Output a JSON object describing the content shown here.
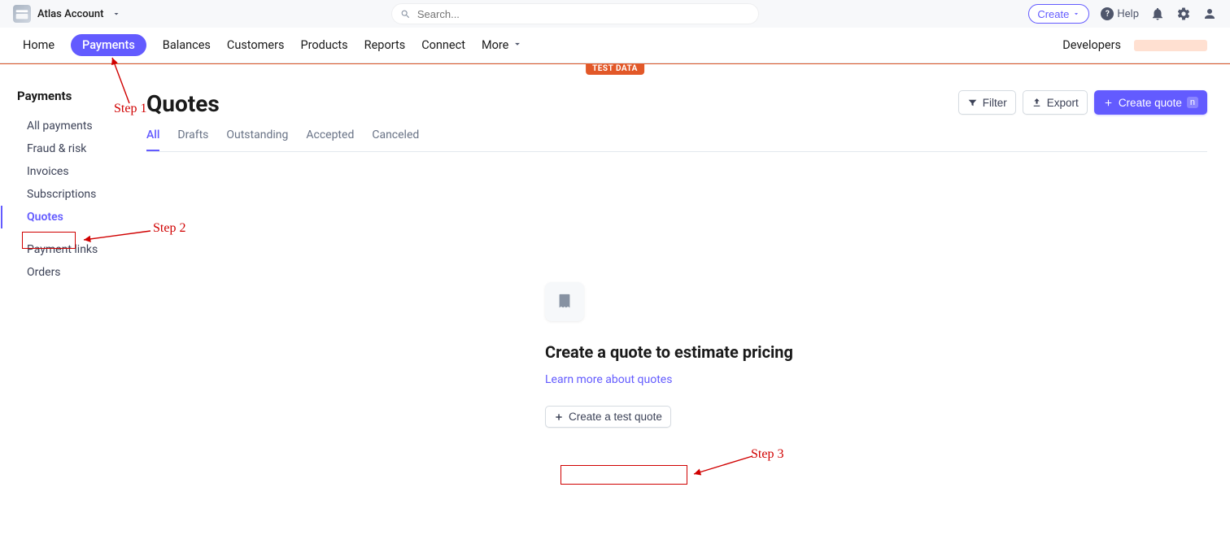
{
  "topbar": {
    "account_name": "Atlas Account",
    "search_placeholder": "Search...",
    "create_label": "Create",
    "help_label": "Help"
  },
  "mainnav": {
    "items": [
      {
        "label": "Home",
        "active": false
      },
      {
        "label": "Payments",
        "active": true
      },
      {
        "label": "Balances",
        "active": false
      },
      {
        "label": "Customers",
        "active": false
      },
      {
        "label": "Products",
        "active": false
      },
      {
        "label": "Reports",
        "active": false
      },
      {
        "label": "Connect",
        "active": false
      },
      {
        "label": "More",
        "active": false,
        "has_chevron": true
      }
    ],
    "developers_label": "Developers"
  },
  "testdata_badge": "TEST DATA",
  "sidebar": {
    "title": "Payments",
    "items_top": [
      {
        "label": "All payments"
      },
      {
        "label": "Fraud & risk"
      },
      {
        "label": "Invoices"
      },
      {
        "label": "Subscriptions"
      },
      {
        "label": "Quotes",
        "active": true
      }
    ],
    "items_bottom": [
      {
        "label": "Payment links"
      },
      {
        "label": "Orders"
      }
    ]
  },
  "page": {
    "title": "Quotes",
    "actions": {
      "filter_label": "Filter",
      "export_label": "Export",
      "create_quote_label": "Create quote",
      "create_quote_kbd": "n"
    },
    "tabs": [
      {
        "label": "All",
        "active": true
      },
      {
        "label": "Drafts"
      },
      {
        "label": "Outstanding"
      },
      {
        "label": "Accepted"
      },
      {
        "label": "Canceled"
      }
    ],
    "empty": {
      "title": "Create a quote to estimate pricing",
      "link_text": "Learn more about quotes",
      "button_label": "Create a test quote"
    }
  },
  "annotations": {
    "step1": "Step 1",
    "step2": "Step 2",
    "step3": "Step 3"
  }
}
